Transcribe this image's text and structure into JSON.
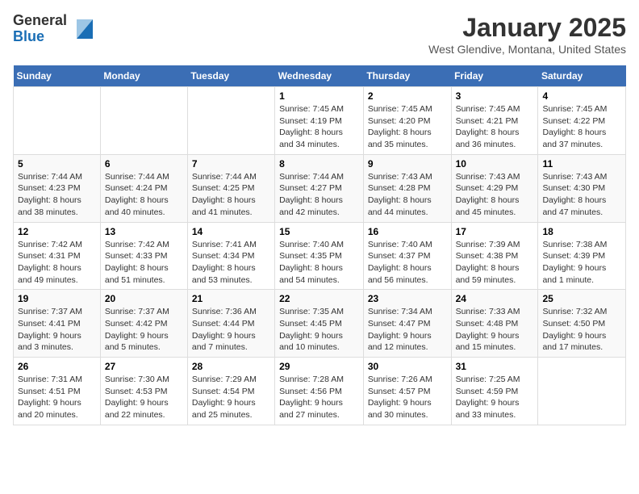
{
  "logo": {
    "general": "General",
    "blue": "Blue"
  },
  "title": "January 2025",
  "location": "West Glendive, Montana, United States",
  "weekdays": [
    "Sunday",
    "Monday",
    "Tuesday",
    "Wednesday",
    "Thursday",
    "Friday",
    "Saturday"
  ],
  "weeks": [
    [
      {
        "day": "",
        "info": ""
      },
      {
        "day": "",
        "info": ""
      },
      {
        "day": "",
        "info": ""
      },
      {
        "day": "1",
        "info": "Sunrise: 7:45 AM\nSunset: 4:19 PM\nDaylight: 8 hours\nand 34 minutes."
      },
      {
        "day": "2",
        "info": "Sunrise: 7:45 AM\nSunset: 4:20 PM\nDaylight: 8 hours\nand 35 minutes."
      },
      {
        "day": "3",
        "info": "Sunrise: 7:45 AM\nSunset: 4:21 PM\nDaylight: 8 hours\nand 36 minutes."
      },
      {
        "day": "4",
        "info": "Sunrise: 7:45 AM\nSunset: 4:22 PM\nDaylight: 8 hours\nand 37 minutes."
      }
    ],
    [
      {
        "day": "5",
        "info": "Sunrise: 7:44 AM\nSunset: 4:23 PM\nDaylight: 8 hours\nand 38 minutes."
      },
      {
        "day": "6",
        "info": "Sunrise: 7:44 AM\nSunset: 4:24 PM\nDaylight: 8 hours\nand 40 minutes."
      },
      {
        "day": "7",
        "info": "Sunrise: 7:44 AM\nSunset: 4:25 PM\nDaylight: 8 hours\nand 41 minutes."
      },
      {
        "day": "8",
        "info": "Sunrise: 7:44 AM\nSunset: 4:27 PM\nDaylight: 8 hours\nand 42 minutes."
      },
      {
        "day": "9",
        "info": "Sunrise: 7:43 AM\nSunset: 4:28 PM\nDaylight: 8 hours\nand 44 minutes."
      },
      {
        "day": "10",
        "info": "Sunrise: 7:43 AM\nSunset: 4:29 PM\nDaylight: 8 hours\nand 45 minutes."
      },
      {
        "day": "11",
        "info": "Sunrise: 7:43 AM\nSunset: 4:30 PM\nDaylight: 8 hours\nand 47 minutes."
      }
    ],
    [
      {
        "day": "12",
        "info": "Sunrise: 7:42 AM\nSunset: 4:31 PM\nDaylight: 8 hours\nand 49 minutes."
      },
      {
        "day": "13",
        "info": "Sunrise: 7:42 AM\nSunset: 4:33 PM\nDaylight: 8 hours\nand 51 minutes."
      },
      {
        "day": "14",
        "info": "Sunrise: 7:41 AM\nSunset: 4:34 PM\nDaylight: 8 hours\nand 53 minutes."
      },
      {
        "day": "15",
        "info": "Sunrise: 7:40 AM\nSunset: 4:35 PM\nDaylight: 8 hours\nand 54 minutes."
      },
      {
        "day": "16",
        "info": "Sunrise: 7:40 AM\nSunset: 4:37 PM\nDaylight: 8 hours\nand 56 minutes."
      },
      {
        "day": "17",
        "info": "Sunrise: 7:39 AM\nSunset: 4:38 PM\nDaylight: 8 hours\nand 59 minutes."
      },
      {
        "day": "18",
        "info": "Sunrise: 7:38 AM\nSunset: 4:39 PM\nDaylight: 9 hours\nand 1 minute."
      }
    ],
    [
      {
        "day": "19",
        "info": "Sunrise: 7:37 AM\nSunset: 4:41 PM\nDaylight: 9 hours\nand 3 minutes."
      },
      {
        "day": "20",
        "info": "Sunrise: 7:37 AM\nSunset: 4:42 PM\nDaylight: 9 hours\nand 5 minutes."
      },
      {
        "day": "21",
        "info": "Sunrise: 7:36 AM\nSunset: 4:44 PM\nDaylight: 9 hours\nand 7 minutes."
      },
      {
        "day": "22",
        "info": "Sunrise: 7:35 AM\nSunset: 4:45 PM\nDaylight: 9 hours\nand 10 minutes."
      },
      {
        "day": "23",
        "info": "Sunrise: 7:34 AM\nSunset: 4:47 PM\nDaylight: 9 hours\nand 12 minutes."
      },
      {
        "day": "24",
        "info": "Sunrise: 7:33 AM\nSunset: 4:48 PM\nDaylight: 9 hours\nand 15 minutes."
      },
      {
        "day": "25",
        "info": "Sunrise: 7:32 AM\nSunset: 4:50 PM\nDaylight: 9 hours\nand 17 minutes."
      }
    ],
    [
      {
        "day": "26",
        "info": "Sunrise: 7:31 AM\nSunset: 4:51 PM\nDaylight: 9 hours\nand 20 minutes."
      },
      {
        "day": "27",
        "info": "Sunrise: 7:30 AM\nSunset: 4:53 PM\nDaylight: 9 hours\nand 22 minutes."
      },
      {
        "day": "28",
        "info": "Sunrise: 7:29 AM\nSunset: 4:54 PM\nDaylight: 9 hours\nand 25 minutes."
      },
      {
        "day": "29",
        "info": "Sunrise: 7:28 AM\nSunset: 4:56 PM\nDaylight: 9 hours\nand 27 minutes."
      },
      {
        "day": "30",
        "info": "Sunrise: 7:26 AM\nSunset: 4:57 PM\nDaylight: 9 hours\nand 30 minutes."
      },
      {
        "day": "31",
        "info": "Sunrise: 7:25 AM\nSunset: 4:59 PM\nDaylight: 9 hours\nand 33 minutes."
      },
      {
        "day": "",
        "info": ""
      }
    ]
  ]
}
